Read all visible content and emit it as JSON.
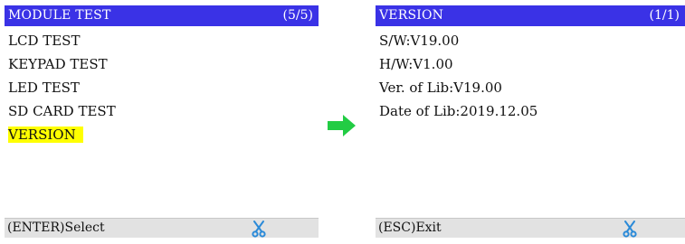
{
  "left_screen": {
    "title": "MODULE TEST",
    "page": "(5/5)",
    "items": [
      {
        "label": "LCD TEST"
      },
      {
        "label": "KEYPAD TEST"
      },
      {
        "label": "LED TEST"
      },
      {
        "label": "SD CARD TEST"
      },
      {
        "label": "VERSION",
        "selected": true
      }
    ],
    "footer": "(ENTER)Select",
    "footer_icon": "scissors-icon"
  },
  "right_screen": {
    "title": "VERSION",
    "page": "(1/1)",
    "lines": [
      "S/W:V19.00",
      "H/W:V1.00",
      "Ver. of Lib:V19.00",
      "Date of Lib:2019.12.05"
    ],
    "footer": "(ESC)Exit",
    "footer_icon": "scissors-icon"
  },
  "transition_icon": "right-arrow-icon",
  "colors": {
    "title_bar": "#3a32e6",
    "selection_highlight": "#ffff00",
    "footer_bg": "#e2e2e2",
    "arrow": "#22cc44",
    "scissors": "#2a8ad8"
  }
}
